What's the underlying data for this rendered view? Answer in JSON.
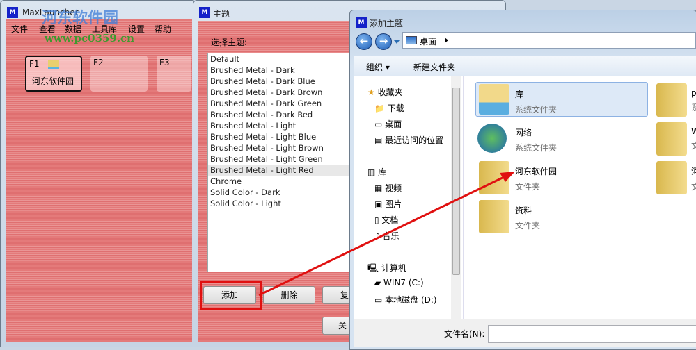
{
  "main_window": {
    "title": "MaxLauncher",
    "menu": [
      "文件",
      "查看",
      "数据",
      "工具库",
      "设置",
      "帮助"
    ],
    "tiles": [
      {
        "key": "F1",
        "label": "河东软件园"
      },
      {
        "key": "F2",
        "label": ""
      },
      {
        "key": "F3",
        "label": ""
      }
    ]
  },
  "watermark": {
    "name": "河东软件园",
    "url": "www.pc0359.cn"
  },
  "theme_window": {
    "title": "主题",
    "prompt": "选择主题:",
    "themes": [
      "Default",
      "Brushed Metal - Dark",
      "Brushed Metal - Dark Blue",
      "Brushed Metal - Dark Brown",
      "Brushed Metal - Dark Green",
      "Brushed Metal - Dark Red",
      "Brushed Metal - Light",
      "Brushed Metal - Light Blue",
      "Brushed Metal - Light Brown",
      "Brushed Metal - Light Green",
      "Brushed Metal - Light Red",
      "Chrome",
      "Solid Color - Dark",
      "Solid Color - Light"
    ],
    "selected": "Brushed Metal - Light Red",
    "buttons": {
      "add": "添加",
      "delete": "删除",
      "copy": "复",
      "close": "关"
    }
  },
  "dialog": {
    "title": "添加主题",
    "address": "桌面",
    "toolbar": {
      "organize": "组织",
      "new_folder": "新建文件夹"
    },
    "nav": {
      "favorites": "收藏夹",
      "downloads": "下载",
      "desktop": "桌面",
      "recent": "最近访问的位置",
      "libraries": "库",
      "videos": "视频",
      "pictures": "图片",
      "documents": "文档",
      "music": "音乐",
      "computer": "计算机",
      "drive_c": "WIN7 (C:)",
      "drive_d": "本地磁盘 (D:)"
    },
    "items": [
      {
        "name": "库",
        "type": "系统文件夹"
      },
      {
        "name": "网络",
        "type": "系统文件夹"
      },
      {
        "name": "河东软件园",
        "type": "文件夹"
      },
      {
        "name": "资料",
        "type": "文件夹"
      },
      {
        "name": "p",
        "type": "系"
      },
      {
        "name": "W",
        "type": "文"
      },
      {
        "name": "河",
        "type": "文"
      }
    ],
    "filename_label": "文件名(N):",
    "filename_value": ""
  },
  "annotation_color": "#e01010"
}
